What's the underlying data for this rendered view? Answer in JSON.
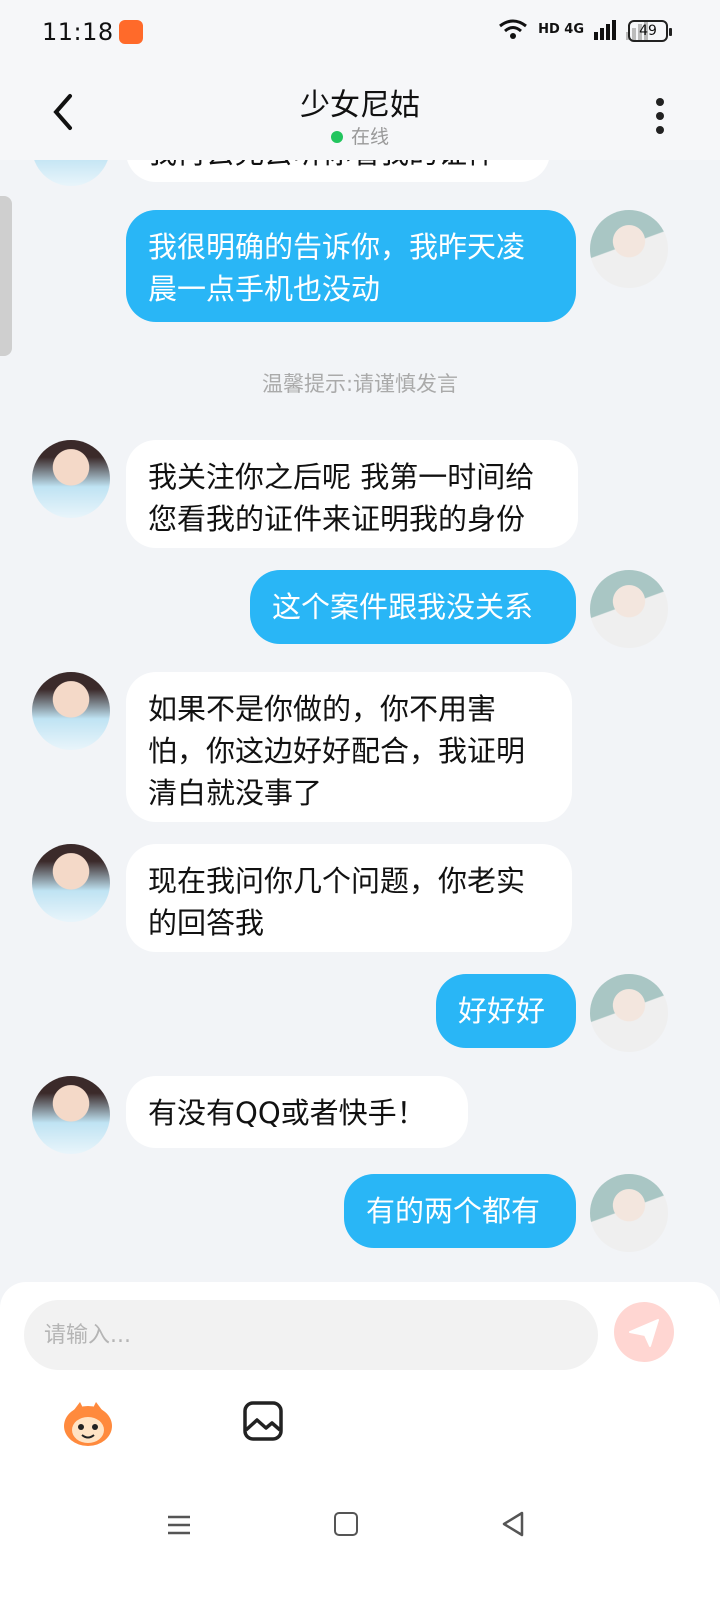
{
  "status": {
    "time": "11:18",
    "network": "HD 4G",
    "battery": "49"
  },
  "header": {
    "title": "少女尼姑",
    "status": "在线"
  },
  "messages": [
    {
      "side": "left",
      "text": "我再去允去听你看我的证件"
    },
    {
      "side": "right",
      "text": "我很明确的告诉你，我昨天凌\n晨一点手机也没动"
    },
    {
      "type": "tip",
      "text": "温馨提示:请谨慎发言"
    },
    {
      "side": "left",
      "text": "我关注你之后呢 我第一时间给\n您看我的证件来证明我的身份"
    },
    {
      "side": "right",
      "text": "这个案件跟我没关系"
    },
    {
      "side": "left",
      "text": "如果不是你做的，你不用害\n怕，你这边好好配合，我证明\n清白就没事了"
    },
    {
      "side": "left",
      "text": "现在我问你几个问题，你老实\n的回答我"
    },
    {
      "side": "right",
      "text": "好好好"
    },
    {
      "side": "left",
      "text": "有没有QQ或者快手！"
    },
    {
      "side": "right",
      "text": "有的两个都有"
    }
  ],
  "composer": {
    "placeholder": "请输入..."
  },
  "icons": [
    "back-arrow-icon",
    "more-icon",
    "wifi-icon",
    "signal-icon",
    "send-icon",
    "emoji-icon",
    "image-icon",
    "menu-icon",
    "home-icon",
    "back-icon"
  ],
  "colors": {
    "accent": "#29b6f6",
    "online": "#22c55e",
    "send": "#ffd6d2"
  }
}
